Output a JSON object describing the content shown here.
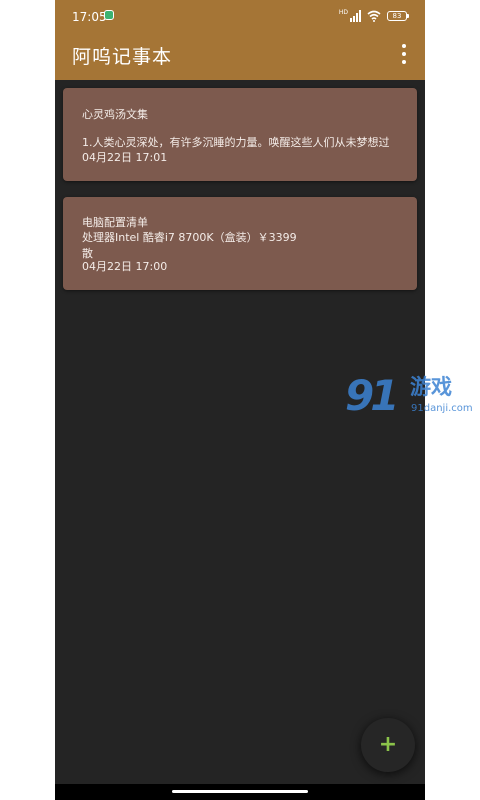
{
  "status_bar": {
    "time": "17:05",
    "signal_label": "HD",
    "battery": "83"
  },
  "app_bar": {
    "title": "阿呜记事本",
    "menu_icon": "more-vert-icon"
  },
  "notes": [
    {
      "title": "心灵鸡汤文集",
      "body": "1.人类心灵深处，有许多沉睡的力量。唤醒这些人们从未梦想过",
      "time": "04月22日 17:01"
    },
    {
      "title": "电脑配置清单",
      "body": "处理器Intel 酷睿i7 8700K（盒装）￥3399\n散",
      "time": "04月22日 17:00"
    }
  ],
  "fab": {
    "icon": "add-icon",
    "glyph": "+"
  },
  "watermark": {
    "logo": "91",
    "game_text": "游戏",
    "domain": "91danji.com"
  },
  "colors": {
    "app_bar": "#a57536",
    "background": "#242424",
    "card": "#7d5a4e",
    "fab_icon": "#8bc34a"
  }
}
